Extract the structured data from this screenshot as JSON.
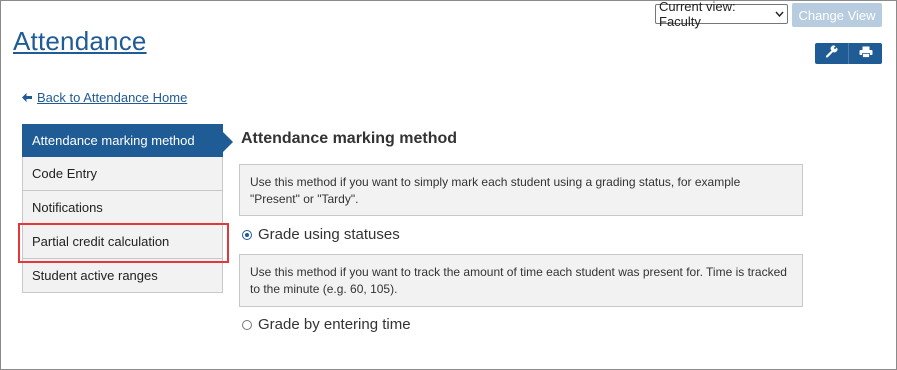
{
  "header": {
    "title": "Attendance",
    "view_select": {
      "value": "Current view: Faculty",
      "options": [
        "Current view: Faculty"
      ]
    },
    "change_view_label": "Change View",
    "tools": {
      "settings_icon": "wrench-icon",
      "print_icon": "printer-icon"
    }
  },
  "back_link": {
    "label": "Back to Attendance Home",
    "icon": "arrow-left-icon"
  },
  "sidebar": {
    "items": [
      {
        "label": "Attendance marking method",
        "active": true
      },
      {
        "label": "Code Entry",
        "active": false
      },
      {
        "label": "Notifications",
        "active": false
      },
      {
        "label": "Partial credit calculation",
        "active": false,
        "highlighted": true
      },
      {
        "label": "Student active ranges",
        "active": false
      }
    ]
  },
  "main": {
    "section_title": "Attendance marking method",
    "option1": {
      "description": "Use this method if you want to simply mark each student using a grading status, for example \"Present\" or \"Tardy\".",
      "label": "Grade using statuses",
      "selected": true
    },
    "option2": {
      "description": "Use this method if you want to track the amount of time each student was present for. Time is tracked to the minute (e.g. 60, 105).",
      "label": "Grade by entering time",
      "selected": false
    }
  },
  "colors": {
    "primary": "#1f5b94",
    "highlight": "#e0383b",
    "panel_bg": "#f2f2f2",
    "disabled_button": "#b8cce0"
  }
}
